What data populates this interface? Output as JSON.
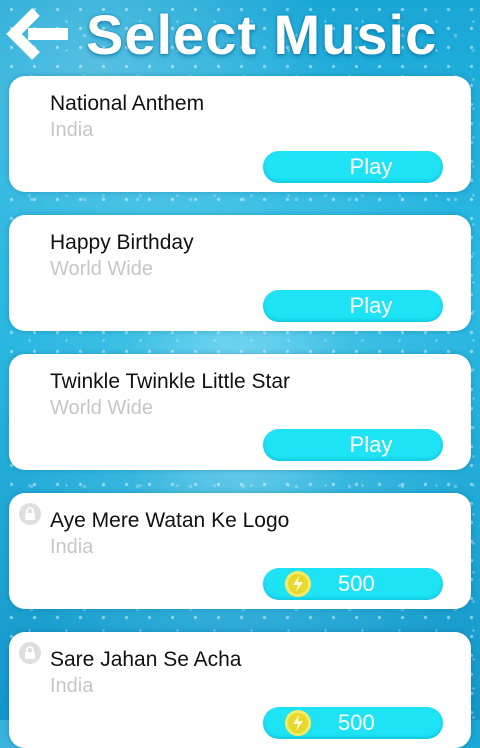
{
  "header": {
    "title": "Select Music",
    "back_icon": "chevron-left-icon"
  },
  "songs": [
    {
      "name": "National Anthem",
      "region": "India",
      "button": "Play",
      "locked": false
    },
    {
      "name": "Happy Birthday",
      "region": "World Wide",
      "button": "Play",
      "locked": false
    },
    {
      "name": "Twinkle Twinkle Little Star",
      "region": "World Wide",
      "button": "Play",
      "locked": false
    },
    {
      "name": "Aye Mere Watan Ke Logo",
      "region": "India",
      "price": "500",
      "locked": true,
      "price_icon": "coin-icon"
    },
    {
      "name": "Sare Jahan Se Acha",
      "region": "India",
      "price": "500",
      "locked": true,
      "price_icon": "coin-icon"
    }
  ],
  "colors": {
    "background": "#1fa9d8",
    "button": "#1de3f5",
    "card": "#ffffff",
    "region_text": "#c6c6c6",
    "coin": "#e6d92a"
  }
}
